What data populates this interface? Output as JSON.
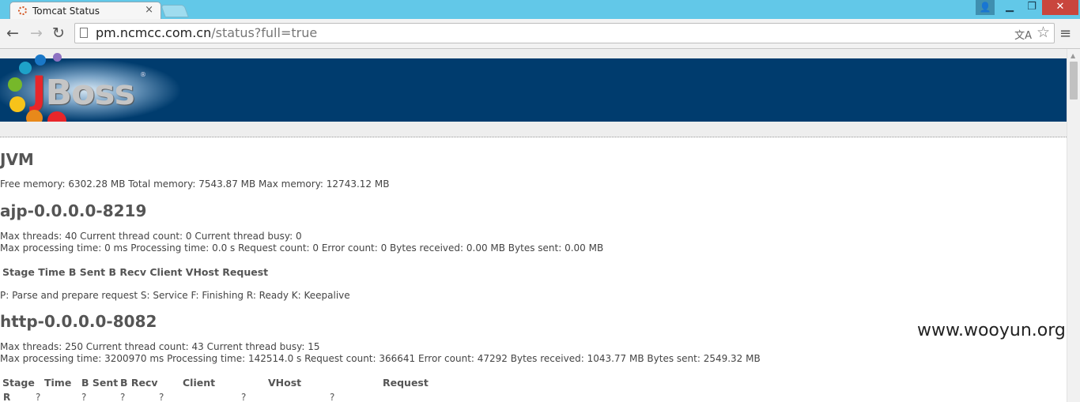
{
  "browser": {
    "tab_title": "Tomcat Status",
    "tab_close": "×",
    "window_user": "👤",
    "window_minimize": "▁",
    "window_maximize": "❐",
    "window_close": "✕",
    "back": "←",
    "forward": "→",
    "reload": "↻",
    "url_host": "pm.ncmcc.com.cn",
    "url_path": "/status?full=true",
    "star": "☆",
    "menu": "≡"
  },
  "logo": {
    "text_j": "J",
    "text_rest": "Boss",
    "registered": "®",
    "dot_colors": [
      "#8e72c2",
      "#1a78c8",
      "#1ea2c8",
      "#76b82a",
      "#f7c31a",
      "#e8891a",
      "#e8262a"
    ]
  },
  "sections": {
    "jvm": {
      "heading": "JVM",
      "line": "Free memory: 6302.28 MB Total memory: 7543.87 MB Max memory: 12743.12 MB"
    },
    "ajp": {
      "heading": "ajp-0.0.0.0-8219",
      "line1": "Max threads: 40 Current thread count: 0 Current thread busy: 0",
      "line2": "Max processing time: 0 ms Processing time: 0.0 s Request count: 0 Error count: 0 Bytes received: 0.00 MB Bytes sent: 0.00 MB",
      "table_header": "Stage Time B Sent B Recv Client VHost Request",
      "legend": "P: Parse and prepare request S: Service F: Finishing R: Ready K: Keepalive"
    },
    "http": {
      "heading": "http-0.0.0.0-8082",
      "line1": "Max threads: 250 Current thread count: 43 Current thread busy: 15",
      "line2": "Max processing time: 3200970 ms Processing time: 142514.0 s Request count: 366641 Error count: 47292 Bytes received: 1043.77 MB Bytes sent: 2549.32 MB",
      "columns": [
        "Stage",
        "Time",
        "B Sent",
        "B Recv",
        "Client",
        "VHost",
        "Request"
      ],
      "row": [
        "R",
        "?",
        "?",
        "?",
        "?",
        "?",
        "?"
      ]
    }
  },
  "watermark": "www.wooyun.org"
}
